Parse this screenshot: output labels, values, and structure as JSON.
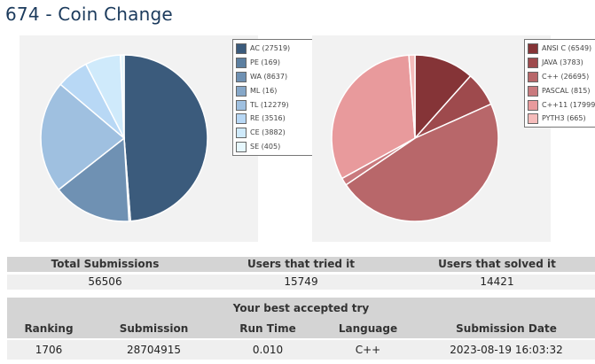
{
  "page": {
    "title": "674 - Coin Change"
  },
  "verdict_chart": {
    "legend": [
      {
        "label": "AC (27519)",
        "value": 27519,
        "color": "#3b5b7c"
      },
      {
        "label": "PE (169)",
        "value": 169,
        "color": "#5c7fa0"
      },
      {
        "label": "WA (8637)",
        "value": 8637,
        "color": "#6f91b3"
      },
      {
        "label": "ML (16)",
        "value": 16,
        "color": "#86a7c8"
      },
      {
        "label": "TL (12279)",
        "value": 12279,
        "color": "#9fc0e0"
      },
      {
        "label": "RE (3516)",
        "value": 3516,
        "color": "#b8d8f5"
      },
      {
        "label": "CE (3882)",
        "value": 3882,
        "color": "#cfeafb"
      },
      {
        "label": "SE (405)",
        "value": 405,
        "color": "#e6f7fd"
      }
    ]
  },
  "language_chart": {
    "legend": [
      {
        "label": "ANSI C (6549)",
        "value": 6549,
        "color": "#853437"
      },
      {
        "label": "JAVA (3783)",
        "value": 3783,
        "color": "#9e4a4d"
      },
      {
        "label": "C++ (26695)",
        "value": 26695,
        "color": "#b8676a"
      },
      {
        "label": "PASCAL (815)",
        "value": 815,
        "color": "#c97a7e"
      },
      {
        "label": "C++11 (17999",
        "value": 17999,
        "color": "#e89a9c"
      },
      {
        "label": "PYTH3 (665)",
        "value": 665,
        "color": "#f5bcbb"
      }
    ]
  },
  "totals": {
    "headers": [
      "Total Submissions",
      "Users that tried it",
      "Users that solved it"
    ],
    "values": [
      "56506",
      "15749",
      "14421"
    ]
  },
  "best": {
    "caption": "Your best accepted try",
    "headers": [
      "Ranking",
      "Submission",
      "Run Time",
      "Language",
      "Submission Date"
    ],
    "values": [
      "1706",
      "28704915",
      "0.010",
      "C++",
      "2023-08-19 16:03:32"
    ]
  }
}
